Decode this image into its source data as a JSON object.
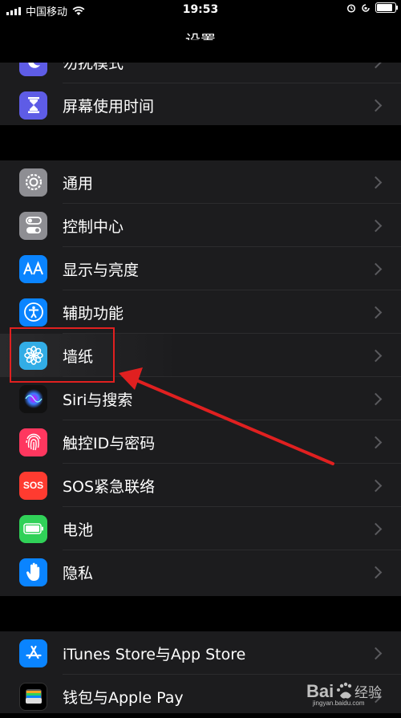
{
  "status_bar": {
    "carrier": "中国移动",
    "time": "19:53"
  },
  "nav": {
    "title": "设置"
  },
  "group1": [
    {
      "label": "勿扰模式",
      "icon": "moon-icon",
      "color": "#5e5ce6"
    },
    {
      "label": "屏幕使用时间",
      "icon": "hourglass-icon",
      "color": "#5e5ce6"
    }
  ],
  "group2": [
    {
      "label": "通用",
      "icon": "gear-icon",
      "color": "#8e8e93"
    },
    {
      "label": "控制中心",
      "icon": "toggles-icon",
      "color": "#8e8e93"
    },
    {
      "label": "显示与亮度",
      "icon": "text-size-icon",
      "color": "#0a84ff"
    },
    {
      "label": "辅助功能",
      "icon": "accessibility-icon",
      "color": "#0a84ff"
    },
    {
      "label": "墙纸",
      "icon": "flower-icon",
      "color": "#32ade6"
    },
    {
      "label": "Siri与搜索",
      "icon": "siri-icon",
      "color": "#111111"
    },
    {
      "label": "触控ID与密码",
      "icon": "fingerprint-icon",
      "color": "#ff375f"
    },
    {
      "label": "SOS紧急联络",
      "icon": "sos-icon",
      "color": "#ff3b30",
      "icon_text": "SOS"
    },
    {
      "label": "电池",
      "icon": "battery-icon",
      "color": "#30d158"
    },
    {
      "label": "隐私",
      "icon": "hand-icon",
      "color": "#0a84ff"
    }
  ],
  "group3": [
    {
      "label": "iTunes Store与App Store",
      "icon": "app-store-icon",
      "color": "#0a84ff"
    },
    {
      "label": "钱包与Apple Pay",
      "icon": "wallet-icon",
      "color": "#1c1c1e"
    }
  ],
  "annotation": {
    "highlight_color": "#e02020"
  },
  "watermark": {
    "brand": "Bai 经验",
    "url": "jingyan.baidu.com"
  }
}
